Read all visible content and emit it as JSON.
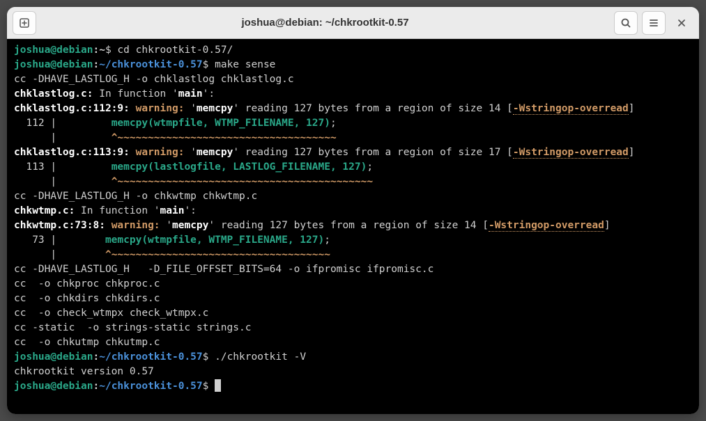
{
  "titlebar": {
    "title": "joshua@debian: ~/chkrootkit-0.57"
  },
  "prompt": {
    "user_host": "joshua@debian",
    "colon": ":",
    "home_marker": "~",
    "dollar": "$"
  },
  "lines": {
    "cd_cmd": " cd chkrootkit-0.57/",
    "path_chk": "~/chkrootkit-0.57",
    "make_cmd": " make sense",
    "cc1": "cc -DHAVE_LASTLOG_H -o chklastlog chklastlog.c",
    "file1_pre": "chklastlog.c:",
    "in_func": " In function '",
    "main": "main",
    "after_main": "':",
    "loc1": "chklastlog.c:112:9: ",
    "warning": "warning: ",
    "q_open": "'",
    "memcpy": "memcpy",
    "msg14": "' reading 127 bytes from a region of size 14 [",
    "msg17": "' reading 127 bytes from a region of size 17 [",
    "opt": "-Wstringop-overread",
    "bracket_close": "]",
    "ln112": "  112 |         ",
    "memcall1": "memcpy(wtmpfile, WTMP_FILENAME, 127)",
    "semicolon": ";",
    "pipe_indent": "      |         ",
    "caret": "^",
    "tilde1": "~~~~~~~~~~~~~~~~~~~~~~~~~~~~~~~~~~~~",
    "loc2": "chklastlog.c:113:9: ",
    "ln113": "  113 |         ",
    "memcall2": "memcpy(lastlogfile, LASTLOG_FILENAME, 127)",
    "tilde2": "~~~~~~~~~~~~~~~~~~~~~~~~~~~~~~~~~~~~~~~~~~",
    "cc2": "cc -DHAVE_LASTLOG_H -o chkwtmp chkwtmp.c",
    "file2_pre": "chkwtmp.c:",
    "loc3": "chkwtmp.c:73:8: ",
    "ln73": "   73 |        ",
    "pipe_indent2": "      |        ",
    "cc3": "cc -DHAVE_LASTLOG_H   -D_FILE_OFFSET_BITS=64 -o ifpromisc ifpromisc.c",
    "cc4": "cc  -o chkproc chkproc.c",
    "cc5": "cc  -o chkdirs chkdirs.c",
    "cc6": "cc  -o check_wtmpx check_wtmpx.c",
    "cc7": "cc -static  -o strings-static strings.c",
    "cc8": "cc  -o chkutmp chkutmp.c",
    "run_cmd": " ./chkrootkit -V",
    "version": "chkrootkit version 0.57",
    "final_space": " "
  }
}
